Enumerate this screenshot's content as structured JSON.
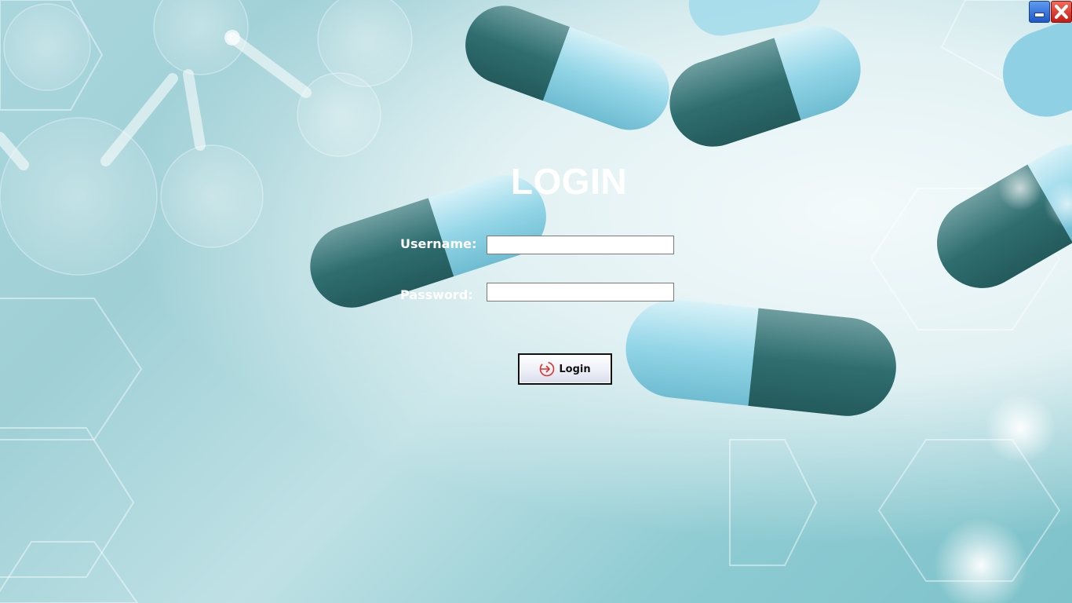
{
  "window": {
    "minimize_icon": "minimize-icon",
    "close_icon": "close-icon"
  },
  "login": {
    "title": "LOGIN",
    "username_label": "Username:",
    "username_value": "",
    "password_label": "Password:",
    "password_value": "",
    "button_label": "Login",
    "button_icon": "login-arrow-icon"
  },
  "colors": {
    "text": "#ffffff",
    "button_icon": "#d9342b",
    "minimize_button": "#2a63d4",
    "close_button": "#d92a1f"
  }
}
